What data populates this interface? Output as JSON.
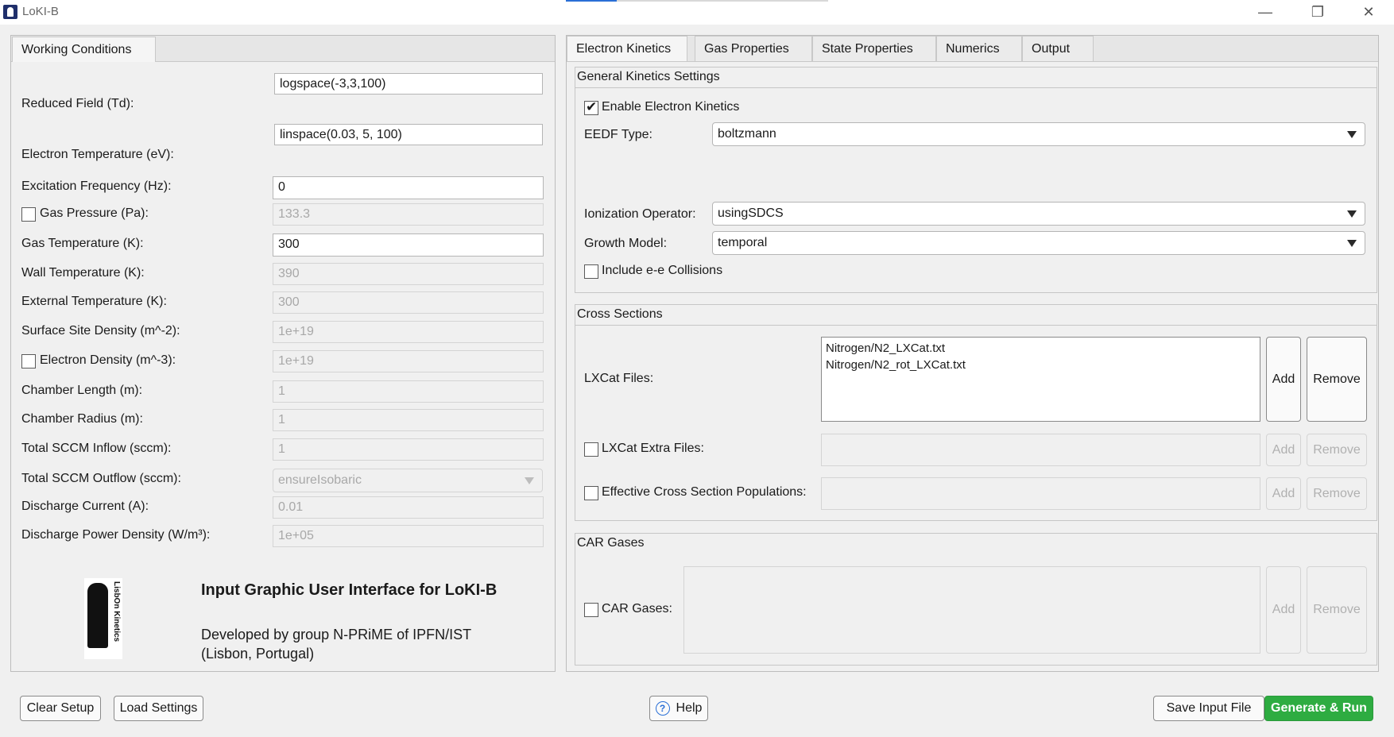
{
  "window": {
    "title": "LoKI-B",
    "minimize_glyph": "—",
    "maximize_glyph": "❐",
    "close_glyph": "✕"
  },
  "left_panel": {
    "tab": "Working Conditions",
    "rows": [
      {
        "label": "Reduced Field (Td):",
        "value": "logspace(-3,3,100)",
        "enabled": true,
        "checkbox": false
      },
      {
        "label": "Electron Temperature (eV):",
        "value": "linspace(0.03, 5, 100)",
        "enabled": true,
        "checkbox": false
      },
      {
        "label": "Excitation Frequency (Hz):",
        "value": "0",
        "enabled": true,
        "checkbox": false
      },
      {
        "label": "Gas Pressure (Pa):",
        "value": "133.3",
        "enabled": false,
        "checkbox": true,
        "checked": false
      },
      {
        "label": "Gas Temperature (K):",
        "value": "300",
        "enabled": true,
        "checkbox": false
      },
      {
        "label": "Wall Temperature (K):",
        "value": "390",
        "enabled": false,
        "checkbox": false
      },
      {
        "label": "External Temperature (K):",
        "value": "300",
        "enabled": false,
        "checkbox": false
      },
      {
        "label": "Surface Site Density (m^-2):",
        "value": "1e+19",
        "enabled": false,
        "checkbox": false
      },
      {
        "label": "Electron Density (m^-3):",
        "value": "1e+19",
        "enabled": false,
        "checkbox": true,
        "checked": false
      },
      {
        "label": "Chamber Length (m):",
        "value": "1",
        "enabled": false,
        "checkbox": false
      },
      {
        "label": "Chamber Radius (m):",
        "value": "1",
        "enabled": false,
        "checkbox": false
      },
      {
        "label": "Total SCCM Inflow (sccm):",
        "value": "1",
        "enabled": false,
        "checkbox": false
      },
      {
        "label": "Total SCCM Outflow (sccm):",
        "value": "ensureIsobaric",
        "enabled": false,
        "checkbox": false,
        "dropdown": true
      },
      {
        "label": "Discharge Current (A):",
        "value": "0.01",
        "enabled": false,
        "checkbox": false
      },
      {
        "label": "Discharge Power Density (W/m³):",
        "value": "1e+05",
        "enabled": false,
        "checkbox": false
      }
    ],
    "logo_text": "LisbOn Kinetics",
    "footer_title": "Input Graphic User Interface for LoKI-B",
    "footer_line1": "Developed by group N-PRiME of IPFN/IST",
    "footer_line2": "(Lisbon, Portugal)"
  },
  "right_panel": {
    "tabs": [
      "Electron Kinetics",
      "Gas Properties",
      "State Properties",
      "Numerics",
      "Output"
    ],
    "active_tab": "Electron Kinetics",
    "general": {
      "title": "General Kinetics Settings",
      "enable_label": "Enable Electron Kinetics",
      "enable_checked": true,
      "eedf_label": "EEDF Type:",
      "eedf_value": "boltzmann",
      "ionization_label": "Ionization Operator:",
      "ionization_value": "usingSDCS",
      "growth_label": "Growth Model:",
      "growth_value": "temporal",
      "ee_label": "Include e-e Collisions",
      "ee_checked": false
    },
    "cross_sections": {
      "title": "Cross Sections",
      "lxcat_label": "LXCat Files:",
      "lxcat_files": [
        "Nitrogen/N2_LXCat.txt",
        "Nitrogen/N2_rot_LXCat.txt"
      ],
      "extra_label": "LXCat Extra Files:",
      "effective_label": "Effective Cross Section Populations:",
      "add_label": "Add",
      "remove_label": "Remove"
    },
    "car": {
      "title": "CAR Gases",
      "label": "CAR Gases:",
      "add_label": "Add",
      "remove_label": "Remove"
    }
  },
  "bottom": {
    "clear_setup": "Clear Setup",
    "load_settings": "Load Settings",
    "help": "Help",
    "help_icon": "?",
    "save_input": "Save Input File",
    "generate_run": "Generate & Run"
  },
  "colors": {
    "primary_button": "#2eac41",
    "accent": "#2a6fd6"
  }
}
